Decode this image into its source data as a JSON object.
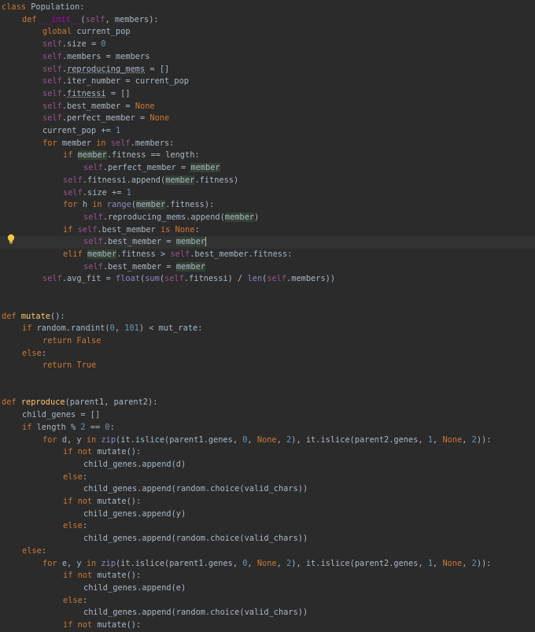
{
  "colors": {
    "background": "#2b2b2b",
    "text": "#a9b7c6",
    "keyword": "#cc7832",
    "self": "#94558d",
    "number": "#6897bb",
    "function_def": "#ffc66d",
    "builtin": "#8888c6",
    "magic": "#b200b2",
    "usage_highlight": "#344134",
    "current_line": "#323232"
  },
  "gutter_icon": "lightbulb-icon",
  "code_lines": [
    {
      "indent": 0,
      "tokens": [
        [
          "class",
          "kw"
        ],
        [
          " Population:",
          ""
        ]
      ]
    },
    {
      "indent": 1,
      "tokens": [
        [
          "def ",
          "kw"
        ],
        [
          "__init__",
          "magic"
        ],
        [
          "(",
          ""
        ],
        [
          "self",
          "self"
        ],
        [
          ", members):",
          ""
        ]
      ]
    },
    {
      "indent": 2,
      "tokens": [
        [
          "global ",
          "kw"
        ],
        [
          "current_pop",
          ""
        ]
      ]
    },
    {
      "indent": 2,
      "tokens": [
        [
          "self",
          "self"
        ],
        [
          ".size = ",
          ""
        ],
        [
          "0",
          "num"
        ]
      ]
    },
    {
      "indent": 2,
      "tokens": [
        [
          "self",
          "self"
        ],
        [
          ".members = members",
          ""
        ]
      ]
    },
    {
      "indent": 2,
      "tokens": [
        [
          "self",
          "self"
        ],
        [
          ".",
          ""
        ],
        [
          "reproducing_mems",
          "uline"
        ],
        [
          " = []",
          ""
        ]
      ]
    },
    {
      "indent": 2,
      "tokens": [
        [
          "self",
          "self"
        ],
        [
          ".iter_number = current_pop",
          ""
        ]
      ]
    },
    {
      "indent": 2,
      "tokens": [
        [
          "self",
          "self"
        ],
        [
          ".",
          ""
        ],
        [
          "fitnessi",
          "uline"
        ],
        [
          " = []",
          ""
        ]
      ]
    },
    {
      "indent": 2,
      "tokens": [
        [
          "self",
          "self"
        ],
        [
          ".best_member = ",
          ""
        ],
        [
          "None",
          "kw"
        ]
      ]
    },
    {
      "indent": 2,
      "tokens": [
        [
          "self",
          "self"
        ],
        [
          ".perfect_member = ",
          ""
        ],
        [
          "None",
          "kw"
        ]
      ]
    },
    {
      "indent": 2,
      "tokens": [
        [
          "current_pop += ",
          ""
        ],
        [
          "1",
          "num"
        ]
      ]
    },
    {
      "indent": 2,
      "tokens": [
        [
          "for ",
          "kw"
        ],
        [
          "member",
          ""
        ],
        [
          " in ",
          "kw"
        ],
        [
          "self",
          "self"
        ],
        [
          ".members:",
          ""
        ]
      ]
    },
    {
      "indent": 3,
      "tokens": [
        [
          "if ",
          "kw"
        ],
        [
          "member",
          "var"
        ],
        [
          ".fitness == length:",
          ""
        ]
      ]
    },
    {
      "indent": 4,
      "tokens": [
        [
          "self",
          "self"
        ],
        [
          ".perfect_member = ",
          ""
        ],
        [
          "member",
          "var"
        ]
      ]
    },
    {
      "indent": 3,
      "tokens": [
        [
          "self",
          "self"
        ],
        [
          ".fitnessi.append(",
          ""
        ],
        [
          "member",
          "var"
        ],
        [
          ".fitness)",
          ""
        ]
      ]
    },
    {
      "indent": 3,
      "tokens": [
        [
          "self",
          "self"
        ],
        [
          ".size += ",
          ""
        ],
        [
          "1",
          "num"
        ]
      ]
    },
    {
      "indent": 3,
      "tokens": [
        [
          "for ",
          "kw"
        ],
        [
          "h",
          ""
        ],
        [
          " in ",
          "kw"
        ],
        [
          "range",
          "bi"
        ],
        [
          "(",
          ""
        ],
        [
          "member",
          "var"
        ],
        [
          ".fitness):",
          ""
        ]
      ]
    },
    {
      "indent": 4,
      "tokens": [
        [
          "self",
          "self"
        ],
        [
          ".reproducing_mems.append(",
          ""
        ],
        [
          "member",
          "var"
        ],
        [
          ")",
          ""
        ]
      ]
    },
    {
      "indent": 3,
      "tokens": [
        [
          "if ",
          "kw"
        ],
        [
          "self",
          "self"
        ],
        [
          ".best_member ",
          ""
        ],
        [
          "is ",
          "kw"
        ],
        [
          "None",
          "kw"
        ],
        [
          ":",
          ""
        ]
      ]
    },
    {
      "indent": 4,
      "current": true,
      "tokens": [
        [
          "self",
          "self"
        ],
        [
          ".best_member = ",
          ""
        ],
        [
          "member",
          "var caret"
        ]
      ]
    },
    {
      "indent": 3,
      "tokens": [
        [
          "elif ",
          "kw"
        ],
        [
          "member",
          "var"
        ],
        [
          ".fitness > ",
          ""
        ],
        [
          "self",
          "self"
        ],
        [
          ".best_member.fitness:",
          ""
        ]
      ]
    },
    {
      "indent": 4,
      "tokens": [
        [
          "self",
          "self"
        ],
        [
          ".best_member = ",
          ""
        ],
        [
          "member",
          "var"
        ]
      ]
    },
    {
      "indent": 2,
      "tokens": [
        [
          "self",
          "self"
        ],
        [
          ".avg_fit = ",
          ""
        ],
        [
          "float",
          "bi"
        ],
        [
          "(",
          ""
        ],
        [
          "sum",
          "bi"
        ],
        [
          "(",
          ""
        ],
        [
          "self",
          "self"
        ],
        [
          ".fitnessi) / ",
          ""
        ],
        [
          "len",
          "bi"
        ],
        [
          "(",
          ""
        ],
        [
          "self",
          "self"
        ],
        [
          ".members))",
          ""
        ]
      ]
    },
    {
      "indent": 0,
      "tokens": []
    },
    {
      "indent": 0,
      "tokens": []
    },
    {
      "indent": 0,
      "tokens": [
        [
          "def ",
          "kw"
        ],
        [
          "mutate",
          "fn"
        ],
        [
          "():",
          ""
        ]
      ]
    },
    {
      "indent": 1,
      "tokens": [
        [
          "if ",
          "kw"
        ],
        [
          "random.randint(",
          ""
        ],
        [
          "0",
          "num"
        ],
        [
          ", ",
          ""
        ],
        [
          "101",
          "num"
        ],
        [
          ") < mut_rate:",
          ""
        ]
      ]
    },
    {
      "indent": 2,
      "tokens": [
        [
          "return ",
          "kw"
        ],
        [
          "False",
          "kw"
        ]
      ]
    },
    {
      "indent": 1,
      "tokens": [
        [
          "else",
          "kw"
        ],
        [
          ":",
          ""
        ]
      ]
    },
    {
      "indent": 2,
      "tokens": [
        [
          "return ",
          "kw"
        ],
        [
          "True",
          "kw"
        ]
      ]
    },
    {
      "indent": 0,
      "tokens": []
    },
    {
      "indent": 0,
      "tokens": []
    },
    {
      "indent": 0,
      "tokens": [
        [
          "def ",
          "kw"
        ],
        [
          "reproduce",
          "fn"
        ],
        [
          "(parent1, parent2):",
          ""
        ]
      ]
    },
    {
      "indent": 1,
      "tokens": [
        [
          "child_genes = []",
          ""
        ]
      ]
    },
    {
      "indent": 1,
      "tokens": [
        [
          "if ",
          "kw"
        ],
        [
          "length % ",
          ""
        ],
        [
          "2",
          "num"
        ],
        [
          " == ",
          ""
        ],
        [
          "0",
          "num"
        ],
        [
          ":",
          ""
        ]
      ]
    },
    {
      "indent": 2,
      "tokens": [
        [
          "for ",
          "kw"
        ],
        [
          "d, y ",
          ""
        ],
        [
          "in ",
          "kw"
        ],
        [
          "zip",
          "bi"
        ],
        [
          "(it.islice(parent1.genes, ",
          ""
        ],
        [
          "0",
          "num"
        ],
        [
          ", ",
          ""
        ],
        [
          "None",
          "kw"
        ],
        [
          ", ",
          ""
        ],
        [
          "2",
          "num"
        ],
        [
          "), it.islice(parent2.genes, ",
          ""
        ],
        [
          "1",
          "num"
        ],
        [
          ", ",
          ""
        ],
        [
          "None",
          "kw"
        ],
        [
          ", ",
          ""
        ],
        [
          "2",
          "num"
        ],
        [
          ")):",
          ""
        ]
      ]
    },
    {
      "indent": 3,
      "tokens": [
        [
          "if not ",
          "kw"
        ],
        [
          "mutate():",
          ""
        ]
      ]
    },
    {
      "indent": 4,
      "tokens": [
        [
          "child_genes.append(d)",
          ""
        ]
      ]
    },
    {
      "indent": 3,
      "tokens": [
        [
          "else",
          "kw"
        ],
        [
          ":",
          ""
        ]
      ]
    },
    {
      "indent": 4,
      "tokens": [
        [
          "child_genes.append(random.choice(valid_chars))",
          ""
        ]
      ]
    },
    {
      "indent": 3,
      "tokens": [
        [
          "if not ",
          "kw"
        ],
        [
          "mutate():",
          ""
        ]
      ]
    },
    {
      "indent": 4,
      "tokens": [
        [
          "child_genes.append(y)",
          ""
        ]
      ]
    },
    {
      "indent": 3,
      "tokens": [
        [
          "else",
          "kw"
        ],
        [
          ":",
          ""
        ]
      ]
    },
    {
      "indent": 4,
      "tokens": [
        [
          "child_genes.append(random.choice(valid_chars))",
          ""
        ]
      ]
    },
    {
      "indent": 1,
      "tokens": [
        [
          "else",
          "kw"
        ],
        [
          ":",
          ""
        ]
      ]
    },
    {
      "indent": 2,
      "tokens": [
        [
          "for ",
          "kw"
        ],
        [
          "e, y ",
          ""
        ],
        [
          "in ",
          "kw"
        ],
        [
          "zip",
          "bi"
        ],
        [
          "(it.islice(parent1.genes, ",
          ""
        ],
        [
          "0",
          "num"
        ],
        [
          ", ",
          ""
        ],
        [
          "None",
          "kw"
        ],
        [
          ", ",
          ""
        ],
        [
          "2",
          "num"
        ],
        [
          "), it.islice(parent2.genes, ",
          ""
        ],
        [
          "1",
          "num"
        ],
        [
          ", ",
          ""
        ],
        [
          "None",
          "kw"
        ],
        [
          ", ",
          ""
        ],
        [
          "2",
          "num"
        ],
        [
          ")):",
          ""
        ]
      ]
    },
    {
      "indent": 3,
      "tokens": [
        [
          "if not ",
          "kw"
        ],
        [
          "mutate():",
          ""
        ]
      ]
    },
    {
      "indent": 4,
      "tokens": [
        [
          "child_genes.append(e)",
          ""
        ]
      ]
    },
    {
      "indent": 3,
      "tokens": [
        [
          "else",
          "kw"
        ],
        [
          ":",
          ""
        ]
      ]
    },
    {
      "indent": 4,
      "tokens": [
        [
          "child_genes.append(random.choice(valid_chars))",
          ""
        ]
      ]
    },
    {
      "indent": 3,
      "tokens": [
        [
          "if not ",
          "kw"
        ],
        [
          "mutate():",
          ""
        ]
      ]
    }
  ]
}
